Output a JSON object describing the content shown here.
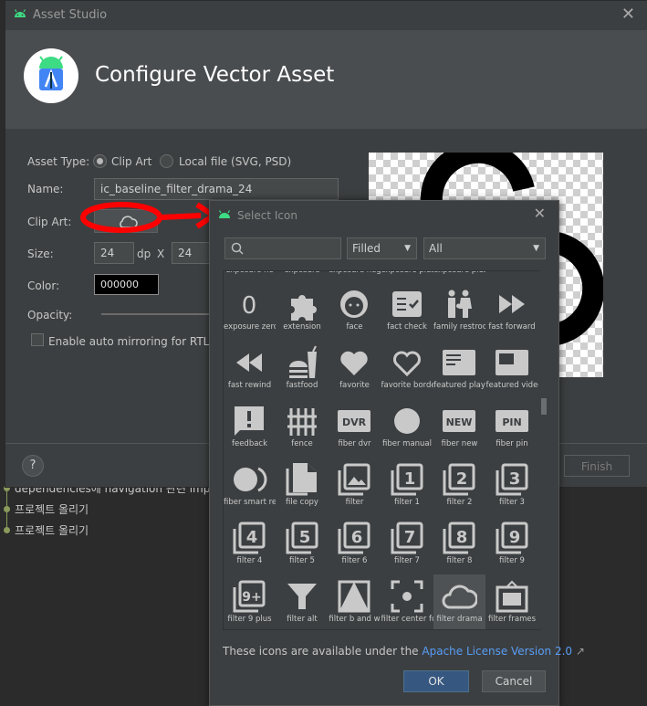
{
  "git": {
    "lines": [
      "dependencies에 navigation 관련 implem",
      "프로젝트 올리기",
      "프로젝트 올리기"
    ]
  },
  "asset_studio": {
    "title": "Asset Studio",
    "heading": "Configure Vector Asset",
    "asset_type_label": "Asset Type:",
    "clip_art_option": "Clip Art",
    "local_file_option": "Local file (SVG, PSD)",
    "name_label": "Name:",
    "name_value": "ic_baseline_filter_drama_24",
    "clip_art_label": "Clip Art:",
    "size_label": "Size:",
    "size_width": "24",
    "size_unit": "dp",
    "size_x": "X",
    "size_height": "24",
    "color_label": "Color:",
    "color_value": "000000",
    "opacity_label": "Opacity:",
    "mirror_label": "Enable auto mirroring for RTL lay",
    "help": "?",
    "finish": "Finish"
  },
  "select_icon": {
    "title": "Select Icon",
    "style_selected": "Filled",
    "category_selected": "All",
    "license_prefix": "These icons are available under the ",
    "license_link": "Apache License Version 2.0",
    "license_arrow": "↗",
    "ok": "OK",
    "cancel": "Cancel",
    "selected_icon": "filter drama",
    "partial_top_labels": [
      "exposure ne",
      "exposure",
      "exposure neg",
      "exposure plus",
      "exposure plus"
    ],
    "icons": [
      {
        "label": "exposure zero",
        "icon": "exposure-zero-icon"
      },
      {
        "label": "extension",
        "icon": "extension-icon"
      },
      {
        "label": "face",
        "icon": "face-icon"
      },
      {
        "label": "fact check",
        "icon": "fact-check-icon"
      },
      {
        "label": "family restroom",
        "icon": "family-restroom-icon"
      },
      {
        "label": "fast forward",
        "icon": "fast-forward-icon"
      },
      {
        "label": "fast rewind",
        "icon": "fast-rewind-icon"
      },
      {
        "label": "fastfood",
        "icon": "fastfood-icon"
      },
      {
        "label": "favorite",
        "icon": "favorite-icon"
      },
      {
        "label": "favorite border",
        "icon": "favorite-border-icon"
      },
      {
        "label": "featured play",
        "icon": "featured-play-list-icon"
      },
      {
        "label": "featured video",
        "icon": "featured-video-icon"
      },
      {
        "label": "feedback",
        "icon": "feedback-icon"
      },
      {
        "label": "fence",
        "icon": "fence-icon"
      },
      {
        "label": "fiber dvr",
        "icon": "fiber-dvr-icon"
      },
      {
        "label": "fiber manual",
        "icon": "fiber-manual-record-icon"
      },
      {
        "label": "fiber new",
        "icon": "fiber-new-icon"
      },
      {
        "label": "fiber pin",
        "icon": "fiber-pin-icon"
      },
      {
        "label": "fiber smart re",
        "icon": "fiber-smart-record-icon"
      },
      {
        "label": "file copy",
        "icon": "file-copy-icon"
      },
      {
        "label": "filter",
        "icon": "filter-icon"
      },
      {
        "label": "filter 1",
        "icon": "filter-1-icon"
      },
      {
        "label": "filter 2",
        "icon": "filter-2-icon"
      },
      {
        "label": "filter 3",
        "icon": "filter-3-icon"
      },
      {
        "label": "filter 4",
        "icon": "filter-4-icon"
      },
      {
        "label": "filter 5",
        "icon": "filter-5-icon"
      },
      {
        "label": "filter 6",
        "icon": "filter-6-icon"
      },
      {
        "label": "filter 7",
        "icon": "filter-7-icon"
      },
      {
        "label": "filter 8",
        "icon": "filter-8-icon"
      },
      {
        "label": "filter 9",
        "icon": "filter-9-icon"
      },
      {
        "label": "filter 9 plus",
        "icon": "filter-9-plus-icon"
      },
      {
        "label": "filter alt",
        "icon": "filter-alt-icon"
      },
      {
        "label": "filter b and w",
        "icon": "filter-b-and-w-icon"
      },
      {
        "label": "filter center fo",
        "icon": "filter-center-focus-icon"
      },
      {
        "label": "filter drama",
        "icon": "filter-drama-icon"
      },
      {
        "label": "filter frames",
        "icon": "filter-frames-icon"
      }
    ]
  },
  "colors": {
    "accent_android": "#3ddc84",
    "annotation_red": "#ff0000",
    "ok_blue": "#365880",
    "link_blue": "#589df6"
  }
}
